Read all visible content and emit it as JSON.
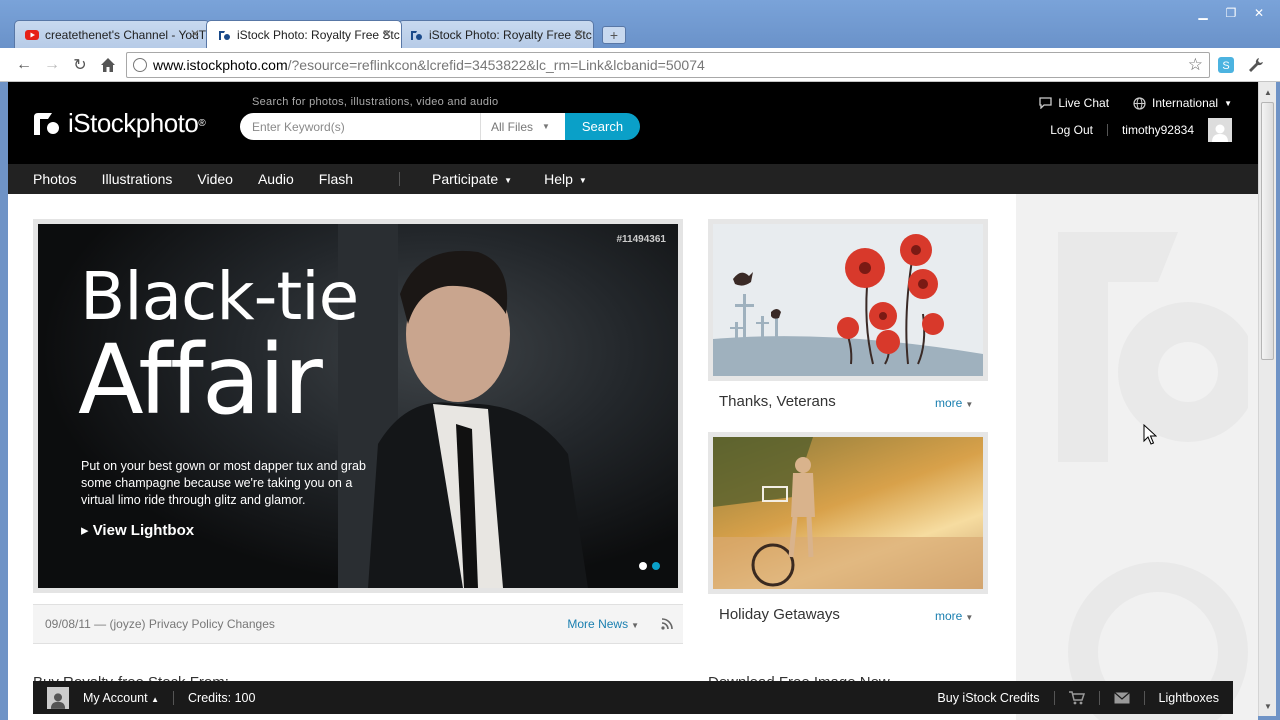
{
  "browser": {
    "tabs": [
      {
        "title": "createthenet's Channel - YouT",
        "active": false,
        "favicon": "youtube-icon"
      },
      {
        "title": "iStock Photo: Royalty Free Stc",
        "active": true,
        "favicon": "istock-icon"
      },
      {
        "title": "iStock Photo: Royalty Free Stc",
        "active": false,
        "favicon": "istock-icon"
      }
    ],
    "new_tab": "+",
    "url_host": "www.istockphoto.com",
    "url_path": "/?esource=reflinkcon&lcrefid=3453822&lc_rm=Link&lcbanid=50074"
  },
  "header": {
    "logo_text": "iStockphoto",
    "search_hint": "Search for photos, illustrations, video and audio",
    "search_placeholder": "Enter Keyword(s)",
    "file_filter": "All Files",
    "search_button": "Search",
    "live_chat": "Live Chat",
    "international": "International",
    "log_out": "Log Out",
    "username": "timothy92834"
  },
  "menu": {
    "items": [
      "Photos",
      "Illustrations",
      "Video",
      "Audio",
      "Flash"
    ],
    "dropdowns": [
      "Participate",
      "Help"
    ]
  },
  "hero": {
    "image_id": "#11494361",
    "title_line1": "Black-tie",
    "title_line2": "Affair",
    "description": "Put on your best gown or most dapper tux and grab some champagne because we're taking you on a virtual limo ride through glitz and glamor.",
    "link": "View Lightbox"
  },
  "news": {
    "text": "09/08/11 — (joyze) Privacy Policy Changes",
    "more": "More News"
  },
  "promos": [
    {
      "caption": "Thanks, Veterans",
      "more": "more"
    },
    {
      "caption": "Holiday Getaways",
      "more": "more"
    }
  ],
  "sections": {
    "left_head": "Buy Royalty-free Stock From:",
    "right_head": "Download Free Image Now"
  },
  "bottom_bar": {
    "my_account": "My Account",
    "credits": "Credits: 100",
    "buy_credits": "Buy iStock Credits",
    "lightboxes": "Lightboxes"
  },
  "colors": {
    "accent": "#0aa0c8",
    "link": "#1a7fb0",
    "header_bg": "#000000",
    "menubar_bg": "#222222"
  }
}
